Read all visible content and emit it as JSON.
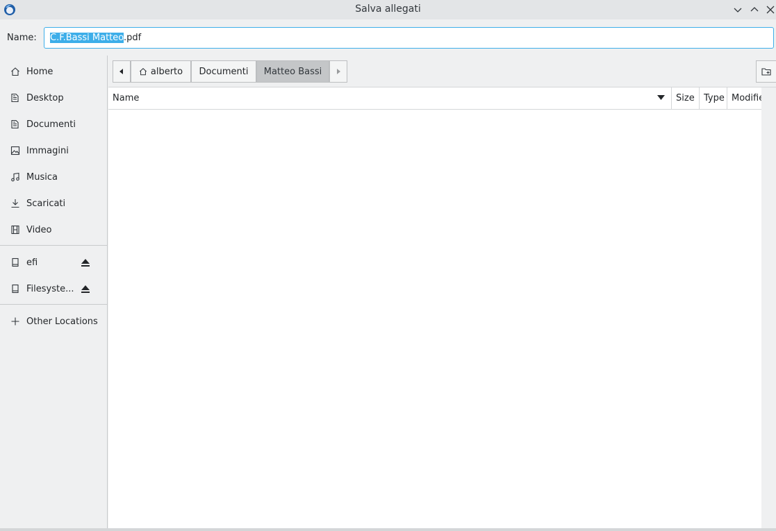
{
  "window": {
    "title": "Salva allegati",
    "icons": {
      "app": "thunderbird-icon",
      "minimize": "chevron-down-icon",
      "maximize": "chevron-up-icon",
      "close": "close-icon"
    }
  },
  "name_field": {
    "label": "Name:",
    "selected_part": "C.F.Bassi Matteo",
    "rest_part": ".pdf"
  },
  "sidebar": {
    "places": [
      {
        "label": "Home",
        "icon": "home-icon"
      },
      {
        "label": "Desktop",
        "icon": "folder-icon"
      },
      {
        "label": "Documenti",
        "icon": "documents-icon"
      },
      {
        "label": "Immagini",
        "icon": "image-icon"
      },
      {
        "label": "Musica",
        "icon": "music-note-icon"
      },
      {
        "label": "Scaricati",
        "icon": "download-icon"
      },
      {
        "label": "Video",
        "icon": "film-icon"
      }
    ],
    "devices": [
      {
        "label": "efi",
        "icon": "drive-icon"
      },
      {
        "label": "Filesyste...",
        "icon": "drive-icon"
      }
    ],
    "other": {
      "label": "Other Locations",
      "icon": "plus-icon"
    }
  },
  "pathbar": {
    "crumbs": [
      "alberto",
      "Documenti",
      "Matteo Bassi"
    ],
    "active": "Matteo Bassi"
  },
  "columns": [
    "Name",
    "Size",
    "Type",
    "Modified"
  ],
  "columns_display": {
    "modified_truncated": "Modifie"
  },
  "colors": {
    "accent": "#3daee9",
    "window_bg": "#eff0f1",
    "list_bg": "#ffffff"
  }
}
